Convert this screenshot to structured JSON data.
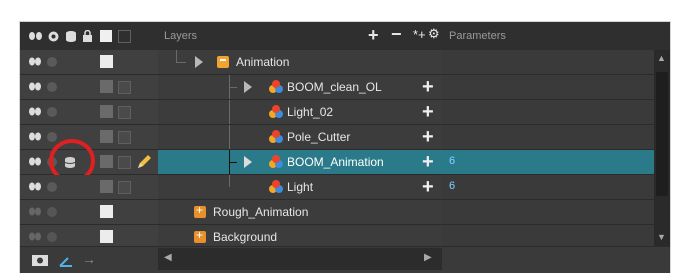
{
  "header": {
    "layers_label": "Layers",
    "parameters_label": "Parameters"
  },
  "rows": [
    {
      "name": "Animation",
      "type": "group",
      "value": ""
    },
    {
      "name": "BOOM_clean_OL",
      "type": "node",
      "value": ""
    },
    {
      "name": "Light_02",
      "type": "node",
      "value": ""
    },
    {
      "name": "Pole_Cutter",
      "type": "node",
      "value": ""
    },
    {
      "name": "BOOM_Animation",
      "type": "node",
      "value": "6",
      "selected": true
    },
    {
      "name": "Light",
      "type": "node",
      "value": "6"
    },
    {
      "name": "Rough_Animation",
      "type": "group",
      "value": ""
    },
    {
      "name": "Background",
      "type": "group",
      "value": ""
    }
  ],
  "highlight": {
    "color": "#e02020"
  },
  "colors": {
    "selected_row": "#2a7a8a",
    "param_value": "#7fd7ff",
    "folder": "#f2a431"
  },
  "icons": [
    "eye-icon",
    "dot-icon",
    "database-icon",
    "lock-icon",
    "pencil-icon",
    "add-layer-icon",
    "delete-layer-icon",
    "settings-icon"
  ]
}
